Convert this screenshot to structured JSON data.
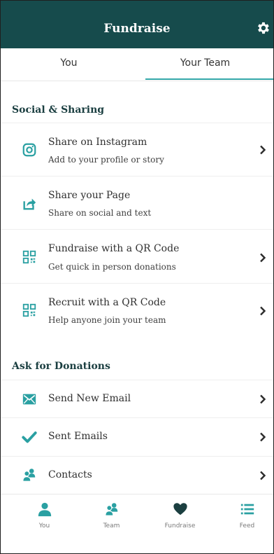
{
  "header": {
    "title": "Fundraise"
  },
  "tabs": [
    {
      "label": "You"
    },
    {
      "label": "Your Team"
    }
  ],
  "sections": [
    {
      "heading": "Social & Sharing",
      "items": [
        {
          "icon": "instagram-icon",
          "title": "Share on Instagram",
          "subtitle": "Add to your profile or story",
          "chevron": true
        },
        {
          "icon": "share-icon",
          "title": "Share your Page",
          "subtitle": "Share on social and text",
          "chevron": false
        },
        {
          "icon": "qr-code-icon",
          "title": "Fundraise with a QR Code",
          "subtitle": "Get quick in person donations",
          "chevron": true
        },
        {
          "icon": "qr-code-icon",
          "title": "Recruit with a QR Code",
          "subtitle": "Help anyone join your team",
          "chevron": true
        }
      ]
    },
    {
      "heading": "Ask for Donations",
      "items": [
        {
          "icon": "email-icon",
          "title": "Send New Email",
          "chevron": true
        },
        {
          "icon": "checkmark-icon",
          "title": "Sent Emails",
          "chevron": true
        },
        {
          "icon": "contacts-icon",
          "title": "Contacts",
          "chevron": true
        }
      ]
    }
  ],
  "bottom_nav": [
    {
      "icon": "person-icon",
      "label": "You"
    },
    {
      "icon": "team-icon",
      "label": "Team"
    },
    {
      "icon": "heart-icon",
      "label": "Fundraise"
    },
    {
      "icon": "list-icon",
      "label": "Feed"
    }
  ],
  "colors": {
    "header_bg": "#164b4c",
    "accent": "#34a7a9",
    "icon_teal": "#2aa0a2",
    "heart": "#1b3f40"
  }
}
